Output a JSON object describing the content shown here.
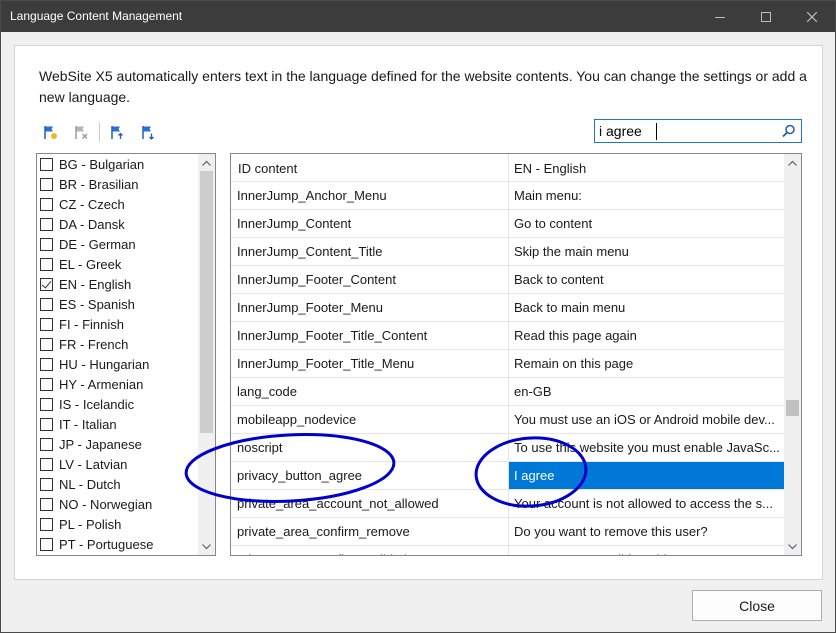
{
  "window": {
    "title": "Language Content Management",
    "buttons": {
      "minimize": "minimize-icon",
      "maximize": "maximize-icon",
      "close": "close-icon"
    }
  },
  "description": "WebSite X5 automatically enters text in the language defined for the website contents. You can change the settings or add a new language.",
  "toolbar": {
    "tools": [
      {
        "name": "add-language",
        "icon": "flag-add-icon"
      },
      {
        "name": "remove-language",
        "icon": "flag-remove-icon"
      },
      {
        "name": "import-language",
        "icon": "flag-import-icon"
      },
      {
        "name": "export-language",
        "icon": "flag-export-icon"
      }
    ]
  },
  "search": {
    "value": "i agree",
    "icon": "search-icon"
  },
  "languages": [
    {
      "label": "BG - Bulgarian",
      "checked": false
    },
    {
      "label": "BR - Brasilian",
      "checked": false
    },
    {
      "label": "CZ - Czech",
      "checked": false
    },
    {
      "label": "DA - Dansk",
      "checked": false
    },
    {
      "label": "DE - German",
      "checked": false
    },
    {
      "label": "EL - Greek",
      "checked": false
    },
    {
      "label": "EN - English",
      "checked": true
    },
    {
      "label": "ES - Spanish",
      "checked": false
    },
    {
      "label": "FI - Finnish",
      "checked": false
    },
    {
      "label": "FR - French",
      "checked": false
    },
    {
      "label": "HU - Hungarian",
      "checked": false
    },
    {
      "label": "HY - Armenian",
      "checked": false
    },
    {
      "label": "IS - Icelandic",
      "checked": false
    },
    {
      "label": "IT - Italian",
      "checked": false
    },
    {
      "label": "JP - Japanese",
      "checked": false
    },
    {
      "label": "LV - Latvian",
      "checked": false
    },
    {
      "label": "NL - Dutch",
      "checked": false
    },
    {
      "label": "NO - Norwegian",
      "checked": false
    },
    {
      "label": "PL - Polish",
      "checked": false
    },
    {
      "label": "PT - Portuguese",
      "checked": false
    }
  ],
  "table": {
    "columns": [
      "ID content",
      "EN - English"
    ],
    "rows": [
      {
        "id": "InnerJump_Anchor_Menu",
        "text": "Main menu:",
        "selected": false
      },
      {
        "id": "InnerJump_Content",
        "text": "Go to content",
        "selected": false
      },
      {
        "id": "InnerJump_Content_Title",
        "text": "Skip the main menu",
        "selected": false
      },
      {
        "id": "InnerJump_Footer_Content",
        "text": "Back to content",
        "selected": false
      },
      {
        "id": "InnerJump_Footer_Menu",
        "text": "Back to main menu",
        "selected": false
      },
      {
        "id": "InnerJump_Footer_Title_Content",
        "text": "Read this page again",
        "selected": false
      },
      {
        "id": "InnerJump_Footer_Title_Menu",
        "text": "Remain on this page",
        "selected": false
      },
      {
        "id": "lang_code",
        "text": "en-GB",
        "selected": false
      },
      {
        "id": "mobileapp_nodevice",
        "text": "You must use an iOS or Android mobile dev...",
        "selected": false
      },
      {
        "id": "noscript",
        "text": "To use this website you must enable JavaSc...",
        "selected": false
      },
      {
        "id": "privacy_button_agree",
        "text": "I agree",
        "selected": true
      },
      {
        "id": "private_area_account_not_allowed",
        "text": "Your account is not allowed to access the s...",
        "selected": false
      },
      {
        "id": "private_area_confirm_remove",
        "text": "Do you want to remove this user?",
        "selected": false
      },
      {
        "id": "private_area_confirm_validation",
        "text": "Do you want to validate this user?",
        "selected": false
      }
    ]
  },
  "close_button": "Close",
  "annotation_color": "#0000cc",
  "accent_color": "#0078d7"
}
